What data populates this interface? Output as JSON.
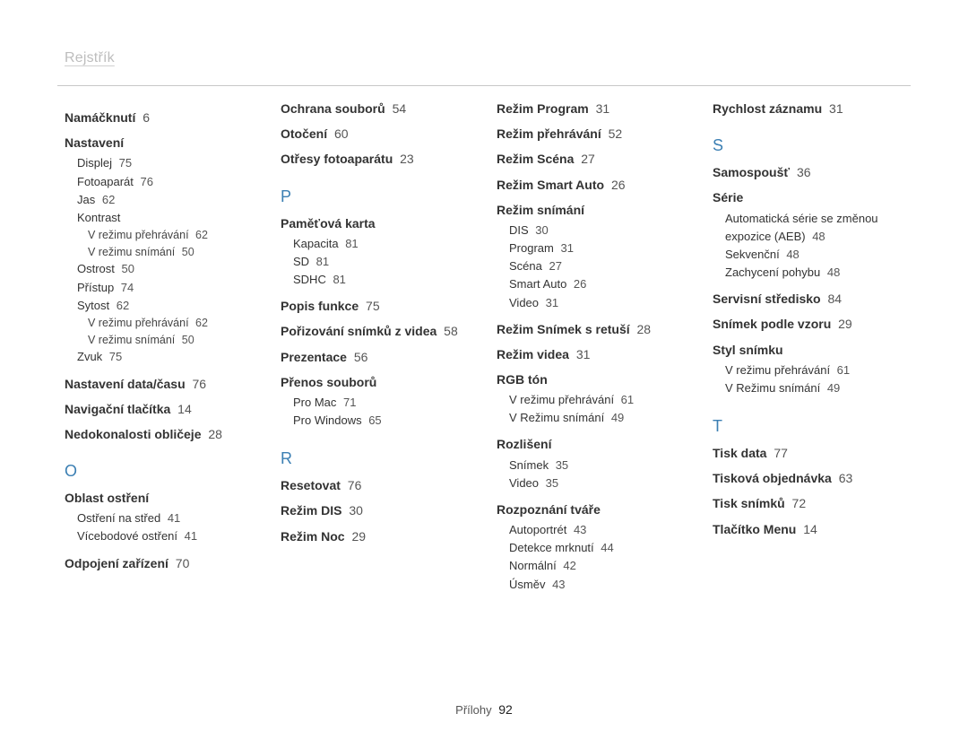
{
  "title": "Rejstřík",
  "footer": {
    "label": "Přílohy",
    "page": "92"
  },
  "columns": [
    {
      "items": [
        {
          "type": "head",
          "label": "Namáčknutí",
          "page": "6"
        },
        {
          "type": "head",
          "label": "Nastavení"
        },
        {
          "type": "sub",
          "label": "Displej",
          "page": "75"
        },
        {
          "type": "sub",
          "label": "Fotoaparát",
          "page": "76"
        },
        {
          "type": "sub",
          "label": "Jas",
          "page": "62"
        },
        {
          "type": "sub",
          "label": "Kontrast"
        },
        {
          "type": "subsub",
          "label": "V režimu přehrávání",
          "page": "62"
        },
        {
          "type": "subsub",
          "label": "V režimu snímání",
          "page": "50"
        },
        {
          "type": "sub",
          "label": "Ostrost",
          "page": "50"
        },
        {
          "type": "sub",
          "label": "Přístup",
          "page": "74"
        },
        {
          "type": "sub",
          "label": "Sytost",
          "page": "62"
        },
        {
          "type": "subsub",
          "label": "V režimu přehrávání",
          "page": "62"
        },
        {
          "type": "subsub",
          "label": "V režimu snímání",
          "page": "50"
        },
        {
          "type": "sub",
          "label": "Zvuk",
          "page": "75"
        },
        {
          "type": "head",
          "label": "Nastavení data/času",
          "page": "76"
        },
        {
          "type": "head",
          "label": "Navigační tlačítka",
          "page": "14"
        },
        {
          "type": "head",
          "label": "Nedokonalosti obličeje",
          "page": "28"
        },
        {
          "type": "letter",
          "label": "O"
        },
        {
          "type": "head",
          "label": "Oblast ostření"
        },
        {
          "type": "sub",
          "label": "Ostření na střed",
          "page": "41"
        },
        {
          "type": "sub",
          "label": "Vícebodové ostření",
          "page": "41"
        },
        {
          "type": "head",
          "label": "Odpojení zařízení",
          "page": "70"
        }
      ]
    },
    {
      "items": [
        {
          "type": "head",
          "label": "Ochrana souborů",
          "page": "54",
          "first": true
        },
        {
          "type": "head",
          "label": "Otočení",
          "page": "60"
        },
        {
          "type": "head",
          "label": "Otřesy fotoaparátu",
          "page": "23"
        },
        {
          "type": "letter",
          "label": "P"
        },
        {
          "type": "head",
          "label": "Paměťová karta"
        },
        {
          "type": "sub",
          "label": "Kapacita",
          "page": "81"
        },
        {
          "type": "sub",
          "label": "SD",
          "page": "81"
        },
        {
          "type": "sub",
          "label": "SDHC",
          "page": "81"
        },
        {
          "type": "head",
          "label": "Popis funkce",
          "page": "75"
        },
        {
          "type": "head",
          "label": "Pořizování snímků z videa",
          "page": "58"
        },
        {
          "type": "head",
          "label": "Prezentace",
          "page": "56"
        },
        {
          "type": "head",
          "label": "Přenos souborů"
        },
        {
          "type": "sub",
          "label": "Pro Mac",
          "page": "71"
        },
        {
          "type": "sub",
          "label": "Pro Windows",
          "page": "65"
        },
        {
          "type": "letter",
          "label": "R"
        },
        {
          "type": "head",
          "label": "Resetovat",
          "page": "76"
        },
        {
          "type": "head",
          "label": "Režim DIS",
          "page": "30"
        },
        {
          "type": "head",
          "label": "Režim Noc",
          "page": "29"
        }
      ]
    },
    {
      "items": [
        {
          "type": "head",
          "label": "Režim Program",
          "page": "31",
          "first": true
        },
        {
          "type": "head",
          "label": "Režim přehrávání",
          "page": "52"
        },
        {
          "type": "head",
          "label": "Režim Scéna",
          "page": "27"
        },
        {
          "type": "head",
          "label": "Režim Smart Auto",
          "page": "26"
        },
        {
          "type": "head",
          "label": "Režim snímání"
        },
        {
          "type": "sub",
          "label": "DIS",
          "page": "30"
        },
        {
          "type": "sub",
          "label": "Program",
          "page": "31"
        },
        {
          "type": "sub",
          "label": "Scéna",
          "page": "27"
        },
        {
          "type": "sub",
          "label": "Smart Auto",
          "page": "26"
        },
        {
          "type": "sub",
          "label": "Video",
          "page": "31"
        },
        {
          "type": "head",
          "label": "Režim Snímek s retuší",
          "page": "28"
        },
        {
          "type": "head",
          "label": "Režim videa",
          "page": "31"
        },
        {
          "type": "head",
          "label": "RGB tón"
        },
        {
          "type": "sub",
          "label": "V režimu přehrávání",
          "page": "61"
        },
        {
          "type": "sub",
          "label": "V Režimu snímání",
          "page": "49"
        },
        {
          "type": "head",
          "label": "Rozlišení"
        },
        {
          "type": "sub",
          "label": "Snímek",
          "page": "35"
        },
        {
          "type": "sub",
          "label": "Video",
          "page": "35"
        },
        {
          "type": "head",
          "label": "Rozpoznání tváře"
        },
        {
          "type": "sub",
          "label": "Autoportrét",
          "page": "43"
        },
        {
          "type": "sub",
          "label": "Detekce mrknutí",
          "page": "44"
        },
        {
          "type": "sub",
          "label": "Normální",
          "page": "42"
        },
        {
          "type": "sub",
          "label": "Úsměv",
          "page": "43"
        }
      ]
    },
    {
      "items": [
        {
          "type": "head",
          "label": "Rychlost záznamu",
          "page": "31",
          "first": true
        },
        {
          "type": "letter",
          "label": "S"
        },
        {
          "type": "head",
          "label": "Samospoušť",
          "page": "36"
        },
        {
          "type": "head",
          "label": "Série"
        },
        {
          "type": "sub",
          "label": "Automatická série se změnou expozice (AEB)",
          "page": "48"
        },
        {
          "type": "sub",
          "label": "Sekvenční",
          "page": "48"
        },
        {
          "type": "sub",
          "label": "Zachycení pohybu",
          "page": "48"
        },
        {
          "type": "head",
          "label": "Servisní středisko",
          "page": "84"
        },
        {
          "type": "head",
          "label": "Snímek podle vzoru",
          "page": "29"
        },
        {
          "type": "head",
          "label": "Styl snímku"
        },
        {
          "type": "sub",
          "label": "V režimu přehrávání",
          "page": "61"
        },
        {
          "type": "sub",
          "label": "V Režimu snímání",
          "page": "49"
        },
        {
          "type": "letter",
          "label": "T"
        },
        {
          "type": "head",
          "label": "Tisk data",
          "page": "77"
        },
        {
          "type": "head",
          "label": "Tisková objednávka",
          "page": "63"
        },
        {
          "type": "head",
          "label": "Tisk snímků",
          "page": "72"
        },
        {
          "type": "head",
          "label": "Tlačítko Menu",
          "page": "14"
        }
      ]
    }
  ]
}
